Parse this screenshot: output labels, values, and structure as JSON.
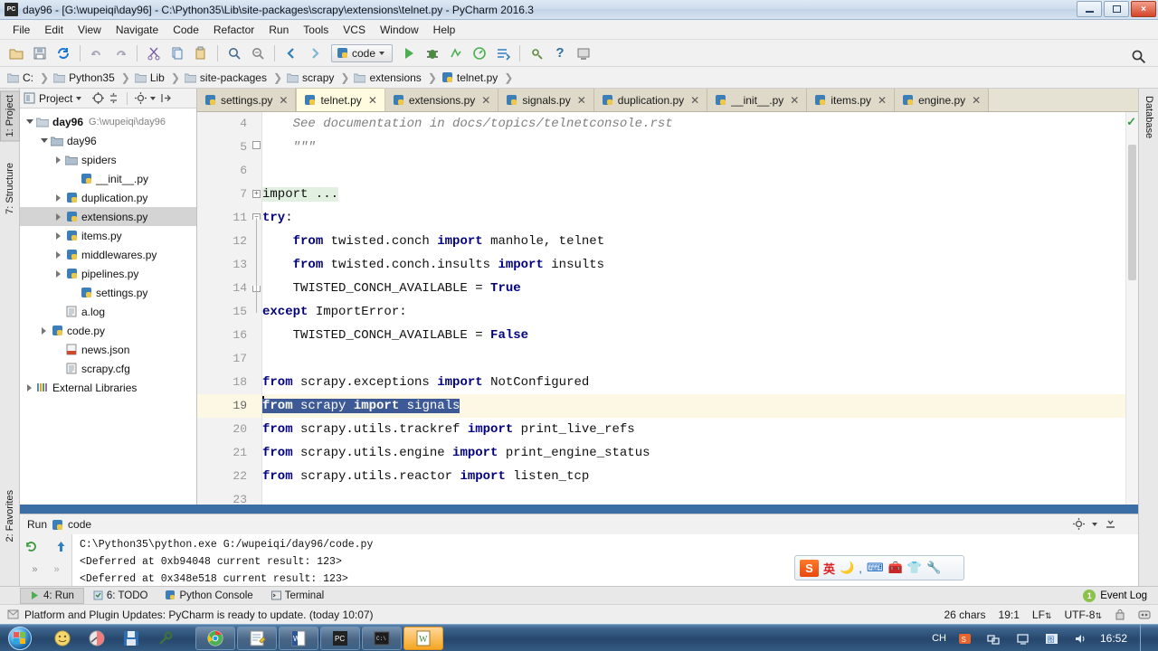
{
  "window": {
    "title": "day96 - [G:\\wupeiqi\\day96] - C:\\Python35\\Lib\\site-packages\\scrapy\\extensions\\telnet.py - PyCharm 2016.3",
    "app_icon_text": "PC",
    "controls": {
      "minimize": "minimize-window",
      "maximize": "maximize-window",
      "close": "×"
    }
  },
  "menu": {
    "items": [
      {
        "label": "File"
      },
      {
        "label": "Edit"
      },
      {
        "label": "View"
      },
      {
        "label": "Navigate"
      },
      {
        "label": "Code"
      },
      {
        "label": "Refactor"
      },
      {
        "label": "Run"
      },
      {
        "label": "Tools"
      },
      {
        "label": "VCS"
      },
      {
        "label": "Window"
      },
      {
        "label": "Help"
      }
    ]
  },
  "toolbar": {
    "run_config": "code",
    "icons": [
      "open-folder-icon",
      "save-all-icon",
      "sync-icon",
      "undo-icon",
      "redo-icon",
      "cut-icon",
      "copy-icon",
      "paste-icon",
      "find-icon",
      "replace-icon",
      "back-icon",
      "forward-icon"
    ],
    "run_icons": [
      "run-icon",
      "debug-icon",
      "coverage-icon",
      "profile-icon",
      "rerun-icon",
      "settings-icon",
      "help-icon",
      "update-icon"
    ],
    "search_icon": "search-icon"
  },
  "breadcrumb": {
    "items": [
      {
        "label": "C:",
        "icon": "folder-icon"
      },
      {
        "label": "Python35",
        "icon": "folder-icon"
      },
      {
        "label": "Lib",
        "icon": "folder-icon"
      },
      {
        "label": "site-packages",
        "icon": "folder-icon"
      },
      {
        "label": "scrapy",
        "icon": "folder-icon"
      },
      {
        "label": "extensions",
        "icon": "folder-icon"
      },
      {
        "label": "telnet.py",
        "icon": "python-file-icon"
      }
    ]
  },
  "left_strip": {
    "tabs": [
      {
        "label": "1: Project",
        "selected": true
      },
      {
        "label": "7: Structure",
        "selected": false
      },
      {
        "label": "2: Favorites",
        "selected": false
      }
    ]
  },
  "right_strip": {
    "tabs": [
      {
        "label": "Database"
      }
    ]
  },
  "project_panel": {
    "title": "Project",
    "tree": [
      {
        "label": "day96",
        "path": "G:\\wupeiqi\\day96",
        "icon": "folder-icon",
        "indent": 0,
        "twisty": "down",
        "bold": true,
        "selected": false
      },
      {
        "label": "day96",
        "path": "",
        "icon": "module-folder-icon",
        "indent": 1,
        "twisty": "down",
        "bold": false,
        "selected": false
      },
      {
        "label": "spiders",
        "path": "",
        "icon": "module-folder-icon",
        "indent": 2,
        "twisty": "right",
        "bold": false,
        "selected": false
      },
      {
        "label": "__init__.py",
        "path": "",
        "icon": "python-file-icon",
        "indent": 3,
        "twisty": "none",
        "bold": false,
        "selected": false
      },
      {
        "label": "duplication.py",
        "path": "",
        "icon": "python-file-icon",
        "indent": 2,
        "twisty": "right",
        "bold": false,
        "selected": false
      },
      {
        "label": "extensions.py",
        "path": "",
        "icon": "python-file-icon",
        "indent": 2,
        "twisty": "right",
        "bold": false,
        "selected": true
      },
      {
        "label": "items.py",
        "path": "",
        "icon": "python-file-icon",
        "indent": 2,
        "twisty": "right",
        "bold": false,
        "selected": false
      },
      {
        "label": "middlewares.py",
        "path": "",
        "icon": "python-file-icon",
        "indent": 2,
        "twisty": "right",
        "bold": false,
        "selected": false
      },
      {
        "label": "pipelines.py",
        "path": "",
        "icon": "python-file-icon",
        "indent": 2,
        "twisty": "right",
        "bold": false,
        "selected": false
      },
      {
        "label": "settings.py",
        "path": "",
        "icon": "python-file-icon",
        "indent": 3,
        "twisty": "none",
        "bold": false,
        "selected": false
      },
      {
        "label": "a.log",
        "path": "",
        "icon": "text-file-icon",
        "indent": 1,
        "twisty": "none",
        "bold": false,
        "selected": false
      },
      {
        "label": "code.py",
        "path": "",
        "icon": "python-file-icon",
        "indent": 1,
        "twisty": "right",
        "bold": false,
        "selected": false
      },
      {
        "label": "news.json",
        "path": "",
        "icon": "json-file-icon",
        "indent": 1,
        "twisty": "none",
        "bold": false,
        "selected": false
      },
      {
        "label": "scrapy.cfg",
        "path": "",
        "icon": "text-file-icon",
        "indent": 1,
        "twisty": "none",
        "bold": false,
        "selected": false
      },
      {
        "label": "External Libraries",
        "path": "",
        "icon": "libraries-icon",
        "indent": 0,
        "twisty": "right",
        "bold": false,
        "selected": false
      }
    ]
  },
  "editor_tabs": [
    {
      "label": "settings.py",
      "active": false
    },
    {
      "label": "telnet.py",
      "active": true
    },
    {
      "label": "extensions.py",
      "active": false
    },
    {
      "label": "signals.py",
      "active": false
    },
    {
      "label": "duplication.py",
      "active": false
    },
    {
      "label": "__init__.py",
      "active": false
    },
    {
      "label": "items.py",
      "active": false
    },
    {
      "label": "engine.py",
      "active": false
    }
  ],
  "editor": {
    "inspection_status": "✓",
    "lines": [
      {
        "num": "4",
        "current": false,
        "fold": "none",
        "tokens": [
          {
            "t": "    See documentation in docs/topics/telnetconsole.rst",
            "c": "cmt"
          }
        ]
      },
      {
        "num": "5",
        "current": false,
        "fold": "end",
        "tokens": [
          {
            "t": "    \"\"\"",
            "c": "cmt"
          }
        ]
      },
      {
        "num": "6",
        "current": false,
        "fold": "none",
        "tokens": [
          {
            "t": "",
            "c": ""
          }
        ]
      },
      {
        "num": "7",
        "current": false,
        "fold": "plus",
        "tokens": [
          {
            "t": "import ...",
            "c": "folded"
          }
        ]
      },
      {
        "num": "11",
        "current": false,
        "fold": "start",
        "tokens": [
          {
            "t": "try",
            "c": "kw"
          },
          {
            "t": ":",
            "c": ""
          }
        ]
      },
      {
        "num": "12",
        "current": false,
        "fold": "none",
        "tokens": [
          {
            "t": "    ",
            "c": ""
          },
          {
            "t": "from",
            "c": "kw"
          },
          {
            "t": " twisted.conch ",
            "c": ""
          },
          {
            "t": "import",
            "c": "kw"
          },
          {
            "t": " manhole, telnet",
            "c": ""
          }
        ]
      },
      {
        "num": "13",
        "current": false,
        "fold": "none",
        "tokens": [
          {
            "t": "    ",
            "c": ""
          },
          {
            "t": "from",
            "c": "kw"
          },
          {
            "t": " twisted.conch.insults ",
            "c": ""
          },
          {
            "t": "import",
            "c": "kw"
          },
          {
            "t": " insults",
            "c": ""
          }
        ]
      },
      {
        "num": "14",
        "current": false,
        "fold": "end",
        "tokens": [
          {
            "t": "    TWISTED_CONCH_AVAILABLE = ",
            "c": ""
          },
          {
            "t": "True",
            "c": "kw"
          }
        ]
      },
      {
        "num": "15",
        "current": false,
        "fold": "none",
        "tokens": [
          {
            "t": "except",
            "c": "kw"
          },
          {
            "t": " ImportError:",
            "c": ""
          }
        ]
      },
      {
        "num": "16",
        "current": false,
        "fold": "none",
        "tokens": [
          {
            "t": "    TWISTED_CONCH_AVAILABLE = ",
            "c": ""
          },
          {
            "t": "False",
            "c": "kw"
          }
        ]
      },
      {
        "num": "17",
        "current": false,
        "fold": "none",
        "tokens": [
          {
            "t": "",
            "c": ""
          }
        ]
      },
      {
        "num": "18",
        "current": false,
        "fold": "none",
        "tokens": [
          {
            "t": "from",
            "c": "kw"
          },
          {
            "t": " scrapy.exceptions ",
            "c": ""
          },
          {
            "t": "import",
            "c": "kw"
          },
          {
            "t": " NotConfigured",
            "c": ""
          }
        ]
      },
      {
        "num": "19",
        "current": true,
        "fold": "none",
        "caret": true,
        "tokens": [
          {
            "t": "from",
            "c": "kw sel-text"
          },
          {
            "t": " scrapy ",
            "c": "sel-text"
          },
          {
            "t": "import",
            "c": "kw sel-text"
          },
          {
            "t": " signals",
            "c": "sel-text"
          }
        ]
      },
      {
        "num": "20",
        "current": false,
        "fold": "none",
        "tokens": [
          {
            "t": "from",
            "c": "kw"
          },
          {
            "t": " scrapy.utils.trackref ",
            "c": ""
          },
          {
            "t": "import",
            "c": "kw"
          },
          {
            "t": " print_live_refs",
            "c": ""
          }
        ]
      },
      {
        "num": "21",
        "current": false,
        "fold": "none",
        "tokens": [
          {
            "t": "from",
            "c": "kw"
          },
          {
            "t": " scrapy.utils.engine ",
            "c": ""
          },
          {
            "t": "import",
            "c": "kw"
          },
          {
            "t": " print_engine_status",
            "c": ""
          }
        ]
      },
      {
        "num": "22",
        "current": false,
        "fold": "none",
        "tokens": [
          {
            "t": "from",
            "c": "kw"
          },
          {
            "t": " scrapy.utils.reactor ",
            "c": ""
          },
          {
            "t": "import",
            "c": "kw"
          },
          {
            "t": " listen_tcp",
            "c": ""
          }
        ]
      },
      {
        "num": "23",
        "current": false,
        "fold": "none",
        "tokens": [
          {
            "t": "",
            "c": ""
          }
        ]
      }
    ]
  },
  "run_panel": {
    "title": "Run",
    "config_name": "code",
    "console_lines": [
      "C:\\Python35\\python.exe G:/wupeiqi/day96/code.py",
      "<Deferred at 0xb94048 current result: 123>",
      "<Deferred at 0x348e518 current result: 123>"
    ],
    "side_icons": [
      "rerun-icon",
      "up-icon",
      "expand-more-icon",
      "expand-more-2-icon"
    ],
    "header_icons": [
      "settings-icon",
      "collapse-icon"
    ]
  },
  "bottom_bar": {
    "tabs": [
      {
        "label": "4: Run",
        "icon": "run-icon",
        "selected": true
      },
      {
        "label": "6: TODO",
        "icon": "todo-icon",
        "selected": false
      },
      {
        "label": "Python Console",
        "icon": "python-icon",
        "selected": false
      },
      {
        "label": "Terminal",
        "icon": "terminal-icon",
        "selected": false
      }
    ],
    "event_log": {
      "label": "Event Log",
      "count": "1"
    }
  },
  "status_bar": {
    "message": "Platform and Plugin Updates: PyCharm is ready to update. (today 10:07)",
    "chars": "26 chars",
    "caret_position": "19:1",
    "line_separator": "LF",
    "encoding": "UTF-8",
    "lock_icon": "lock-icon",
    "inspection_icon": "inspection-icon"
  },
  "ime_toolbar": {
    "logo": "S",
    "items": [
      "英",
      "moon-icon",
      "comma-icon",
      "keyboard-icon",
      "toolbox-icon",
      "skin-icon",
      "wrench-icon"
    ]
  },
  "taskbar": {
    "start": "start-orb",
    "quick_launch": [
      "media-icon",
      "paint-icon",
      "save-icon",
      "tool-icon"
    ],
    "tasks": [
      {
        "icon": "chrome-icon",
        "active": false
      },
      {
        "icon": "notepad-icon",
        "active": false
      },
      {
        "icon": "word-icon",
        "active": false
      },
      {
        "icon": "pycharm-icon",
        "active": false
      },
      {
        "icon": "cmd-icon",
        "active": false
      },
      {
        "icon": "editor-icon",
        "active": true
      }
    ],
    "tray": [
      "network-icon",
      "monitor-icon",
      "ime-icon",
      "volume-icon"
    ],
    "clock": "16:52",
    "lang": "CH"
  }
}
